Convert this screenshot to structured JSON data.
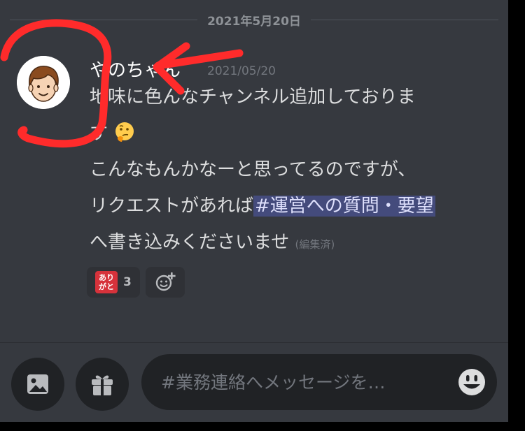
{
  "channel": {
    "date_divider": "2021年5月20日",
    "message": {
      "author": "やのちゃん",
      "timestamp": "2021/05/20",
      "line1": "地味に色んなチャンネル追加しておりま",
      "line2": "す",
      "line3": "こんなもんかなーと思ってるのですが、",
      "line4_before": "リクエストがあれば",
      "mention": "#運営への質問・要望",
      "line5": "へ書き込みくださいませ",
      "edited": "(編集済)"
    },
    "reactions": [
      {
        "icon": "arigato-stamp-icon",
        "label": "あり がと",
        "count": "3"
      },
      {
        "icon": "add-reaction-icon"
      }
    ]
  },
  "composer": {
    "placeholder": "#業務連絡へメッセージを…"
  },
  "colors": {
    "background": "#36393f",
    "annotation": "#ff2b2b",
    "mention_bg": "#444b7c"
  }
}
